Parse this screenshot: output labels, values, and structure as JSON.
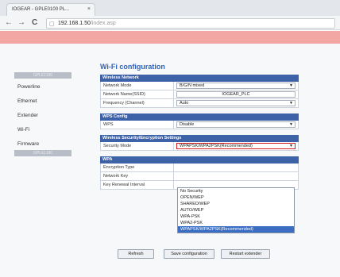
{
  "browser": {
    "tab_title": "IOGEAR - GPLE0100 PL...",
    "tab_close": "×",
    "back": "←",
    "forward": "→",
    "reload": "C",
    "doc_icon": "▢",
    "url_host": "192.168.1.50",
    "url_path": "/index.asp"
  },
  "sidebar": {
    "badge_top": "GPLE1100",
    "items": [
      "Powerline",
      "Ethernet",
      "Extender",
      "Wi-Fi",
      "Firmware"
    ],
    "badge_bottom": "GPLE1100"
  },
  "page": {
    "title": "Wi-Fi configuration",
    "wireless_network": {
      "header": "Wireless Network",
      "rows": [
        {
          "label": "Network Mode",
          "value": "B/G/N mixed"
        },
        {
          "label": "Network Name(SSID)",
          "value": "IOGEAR_PLC"
        },
        {
          "label": "Frequency (Channel)",
          "value": "Auto"
        }
      ]
    },
    "wps": {
      "header": "WPS Config",
      "rows": [
        {
          "label": "WPS",
          "value": "Disable"
        }
      ]
    },
    "security": {
      "header": "Wireless Security/Encryption Settings",
      "rows": [
        {
          "label": "Security Mode",
          "value": "WPAPSK/WPA2PSK(Recommended)"
        }
      ]
    },
    "wpa": {
      "header": "WPA",
      "rows": [
        {
          "label": "Encryption Type",
          "value": ""
        },
        {
          "label": "Network Key",
          "value": ""
        },
        {
          "label": "Key Renewal Interval",
          "value": ""
        }
      ]
    },
    "dropdown_options": [
      "No Security",
      "OPEN/WEP",
      "SHARED/WEP",
      "AUTO/WEP",
      "WPA-PSK",
      "WPA2-PSK",
      "WPAPSK/WPA2PSK(Recommended)"
    ],
    "dropdown_selected": "WPAPSK/WPA2PSK(Recommended)",
    "buttons": {
      "refresh": "Refresh",
      "save": "Save configuration",
      "restart": "Restart extender"
    }
  },
  "colors": {
    "accent_band": "#f3a7a4",
    "section_header": "#3e62a8",
    "title_blue": "#2d63b8",
    "highlight": "#3b6ec2",
    "red_outline": "#d42020"
  }
}
